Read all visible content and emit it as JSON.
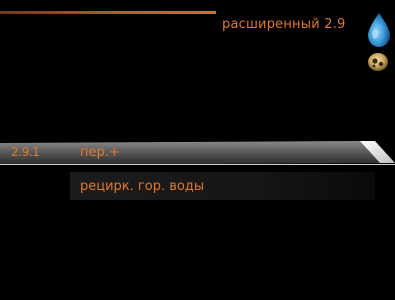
{
  "header": {
    "title": "расширенный  2.9"
  },
  "icons": {
    "status_top": "water-drop-icon",
    "status_bottom": "compressor-icon"
  },
  "colors": {
    "accent": "#e0792f",
    "drop": "#3a9ad9"
  },
  "menu": {
    "items": [
      {
        "number": "2.9.1",
        "label": "пер.+",
        "selected": true
      },
      {
        "number": "",
        "label": "рецирк. гор. воды",
        "selected": false
      }
    ]
  }
}
